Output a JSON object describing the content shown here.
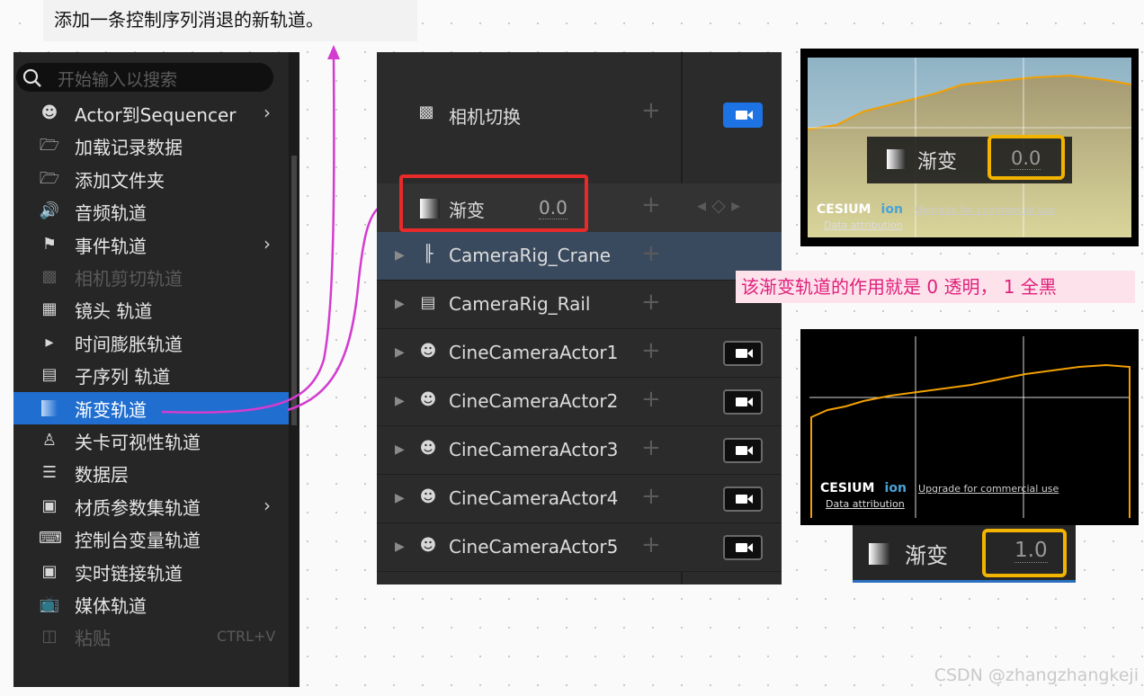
{
  "caption": "添加一条控制序列消退的新轨道。",
  "menu": {
    "search_placeholder": "开始输入以搜索",
    "items": [
      {
        "label": "Actor到Sequencer",
        "icon": "actor-icon",
        "submenu": true
      },
      {
        "label": "加载记录数据",
        "icon": "folder-icon"
      },
      {
        "label": "添加文件夹",
        "icon": "folder-icon"
      },
      {
        "label": "音频轨道",
        "icon": "speaker-icon"
      },
      {
        "label": "事件轨道",
        "icon": "flag-icon",
        "submenu": true
      },
      {
        "label": "相机剪切轨道",
        "icon": "camera-cut-icon",
        "disabled": true
      },
      {
        "label": "镜头 轨道",
        "icon": "film-icon"
      },
      {
        "label": "时间膨胀轨道",
        "icon": "time-dilation-icon"
      },
      {
        "label": "子序列 轨道",
        "icon": "subsequence-icon"
      },
      {
        "label": "渐变轨道",
        "icon": "fade-icon",
        "selected": true
      },
      {
        "label": "关卡可视性轨道",
        "icon": "level-visibility-icon"
      },
      {
        "label": "数据层",
        "icon": "layers-icon"
      },
      {
        "label": "材质参数集轨道",
        "icon": "material-icon",
        "submenu": true
      },
      {
        "label": "控制台变量轨道",
        "icon": "console-icon"
      },
      {
        "label": "实时链接轨道",
        "icon": "live-link-icon"
      },
      {
        "label": "媒体轨道",
        "icon": "media-icon"
      },
      {
        "label": "粘贴",
        "icon": "paste-icon",
        "disabled": true,
        "shortcut": "CTRL+V"
      }
    ]
  },
  "sequencer": {
    "camera_cut": "相机切换",
    "fade_track": {
      "label": "渐变",
      "value": "0.0"
    },
    "tracks": [
      {
        "label": "CameraRig_Crane",
        "icon": "crane-icon",
        "camera": false,
        "selected": true
      },
      {
        "label": "CameraRig_Rail",
        "icon": "rail-icon",
        "camera": false
      },
      {
        "label": "CineCameraActor1",
        "icon": "cine-camera-icon",
        "camera": true
      },
      {
        "label": "CineCameraActor2",
        "icon": "cine-camera-icon",
        "camera": true
      },
      {
        "label": "CineCameraActor3",
        "icon": "cine-camera-icon",
        "camera": true
      },
      {
        "label": "CineCameraActor4",
        "icon": "cine-camera-icon",
        "camera": true
      },
      {
        "label": "CineCameraActor5",
        "icon": "cine-camera-icon",
        "camera": true
      }
    ]
  },
  "preview_top": {
    "label": "渐变",
    "value": "0.0",
    "brand": "CESIUM",
    "brand2": "ion",
    "upgrade": "Upgrade for commercial use",
    "attribution": "Data attribution"
  },
  "note": "该渐变轨道的作用就是 0 透明， 1 全黑",
  "preview_bottom": {
    "brand": "CESIUM",
    "brand2": "ion",
    "upgrade": "Upgrade for commercial use",
    "attribution": "Data attribution"
  },
  "fade_bottom": {
    "label": "渐变",
    "value": "1.0"
  },
  "watermark": "CSDN @zhangzhangkeji",
  "colors": {
    "selection": "#1f6ed0",
    "highlight_red": "#e72a2a",
    "highlight_orange": "#f2b400",
    "annotation_arrow": "#d33ccf",
    "note_text": "#e0207a"
  }
}
